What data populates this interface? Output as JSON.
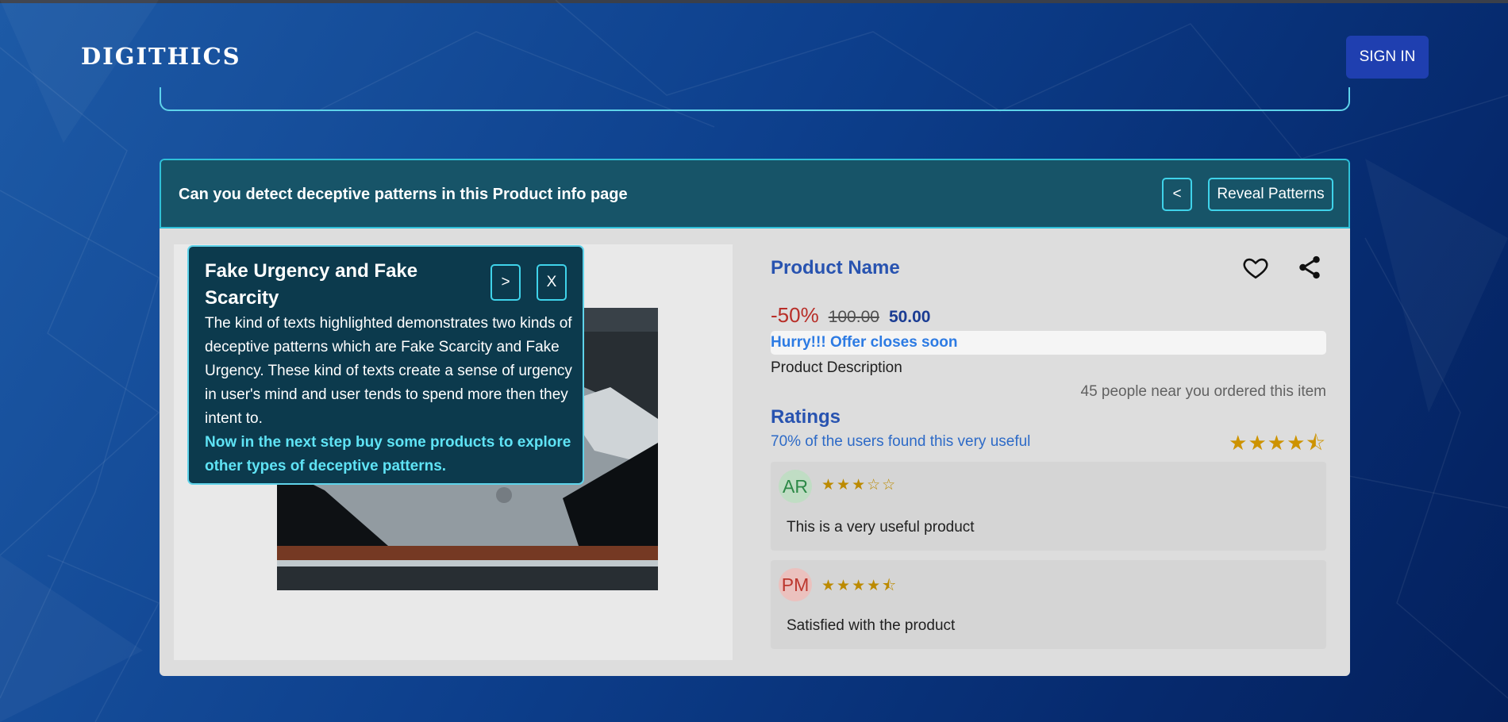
{
  "header": {
    "logo": "DIGITHICS",
    "signin_label": "SIGN IN"
  },
  "card": {
    "title": "Can you detect deceptive patterns in this Product info page",
    "back_label": "<",
    "reveal_label": "Reveal Patterns"
  },
  "product": {
    "name": "Product Name",
    "discount": "-50%",
    "old_price": "100.00",
    "new_price": "50.00",
    "hurry_text": "Hurry!!! Offer closes soon",
    "description": "Product Description",
    "ordered_text": "45 people near you ordered this item",
    "icons": [
      "heart-icon",
      "share-icon"
    ]
  },
  "ratings": {
    "title": "Ratings",
    "useful_text": "70% of the users found this very useful",
    "average_stars": 4.5,
    "average_stars_text": "★★★★⯪",
    "reviews": [
      {
        "initials": "AR",
        "stars": 3,
        "stars_text": "★★★☆☆",
        "text": "This is a very useful product"
      },
      {
        "initials": "PM",
        "stars": 4.5,
        "stars_text": "★★★★⯪",
        "text": "Satisfied with the product"
      }
    ]
  },
  "popup": {
    "title": "Fake Urgency and Fake Scarcity",
    "next_label": ">",
    "close_label": "X",
    "body": "The kind of texts highlighted demonstrates two kinds of deceptive patterns which are Fake Scarcity and Fake Urgency. These kind of texts create a sense of urgency in user's mind and user tends to spend more then they intent to.",
    "cta": "Now in the next step buy some products to explore other types of deceptive patterns."
  },
  "colors": {
    "accent": "#5fd3ea",
    "brand_button": "#1f3fb0",
    "product_blue": "#2a57b8",
    "discount_red": "#c0302a",
    "star_gold": "#d69a00"
  }
}
